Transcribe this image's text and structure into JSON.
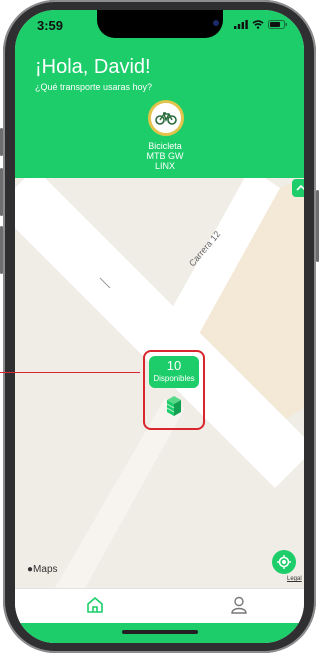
{
  "status_bar": {
    "time": "3:59"
  },
  "header": {
    "greeting": "¡Hola, David!",
    "question": "¿Qué transporte usaras hoy?",
    "vehicle": {
      "line1": "Bicicleta",
      "line2": "MTB GW",
      "line3": "LINX",
      "icon": "bicycle-icon"
    }
  },
  "map": {
    "street_label": "Carrera 12",
    "marker": {
      "count": "10",
      "label": "Disponibles",
      "icon": "station-icon"
    },
    "attribution": "Maps",
    "legal": "Legal"
  },
  "tabbar": {
    "items": [
      {
        "icon": "home-icon"
      },
      {
        "icon": "profile-icon"
      }
    ]
  },
  "colors": {
    "brand_green": "#1ccd6a",
    "highlight_red": "#d9252d",
    "accent_yellow": "#e2c44c"
  }
}
